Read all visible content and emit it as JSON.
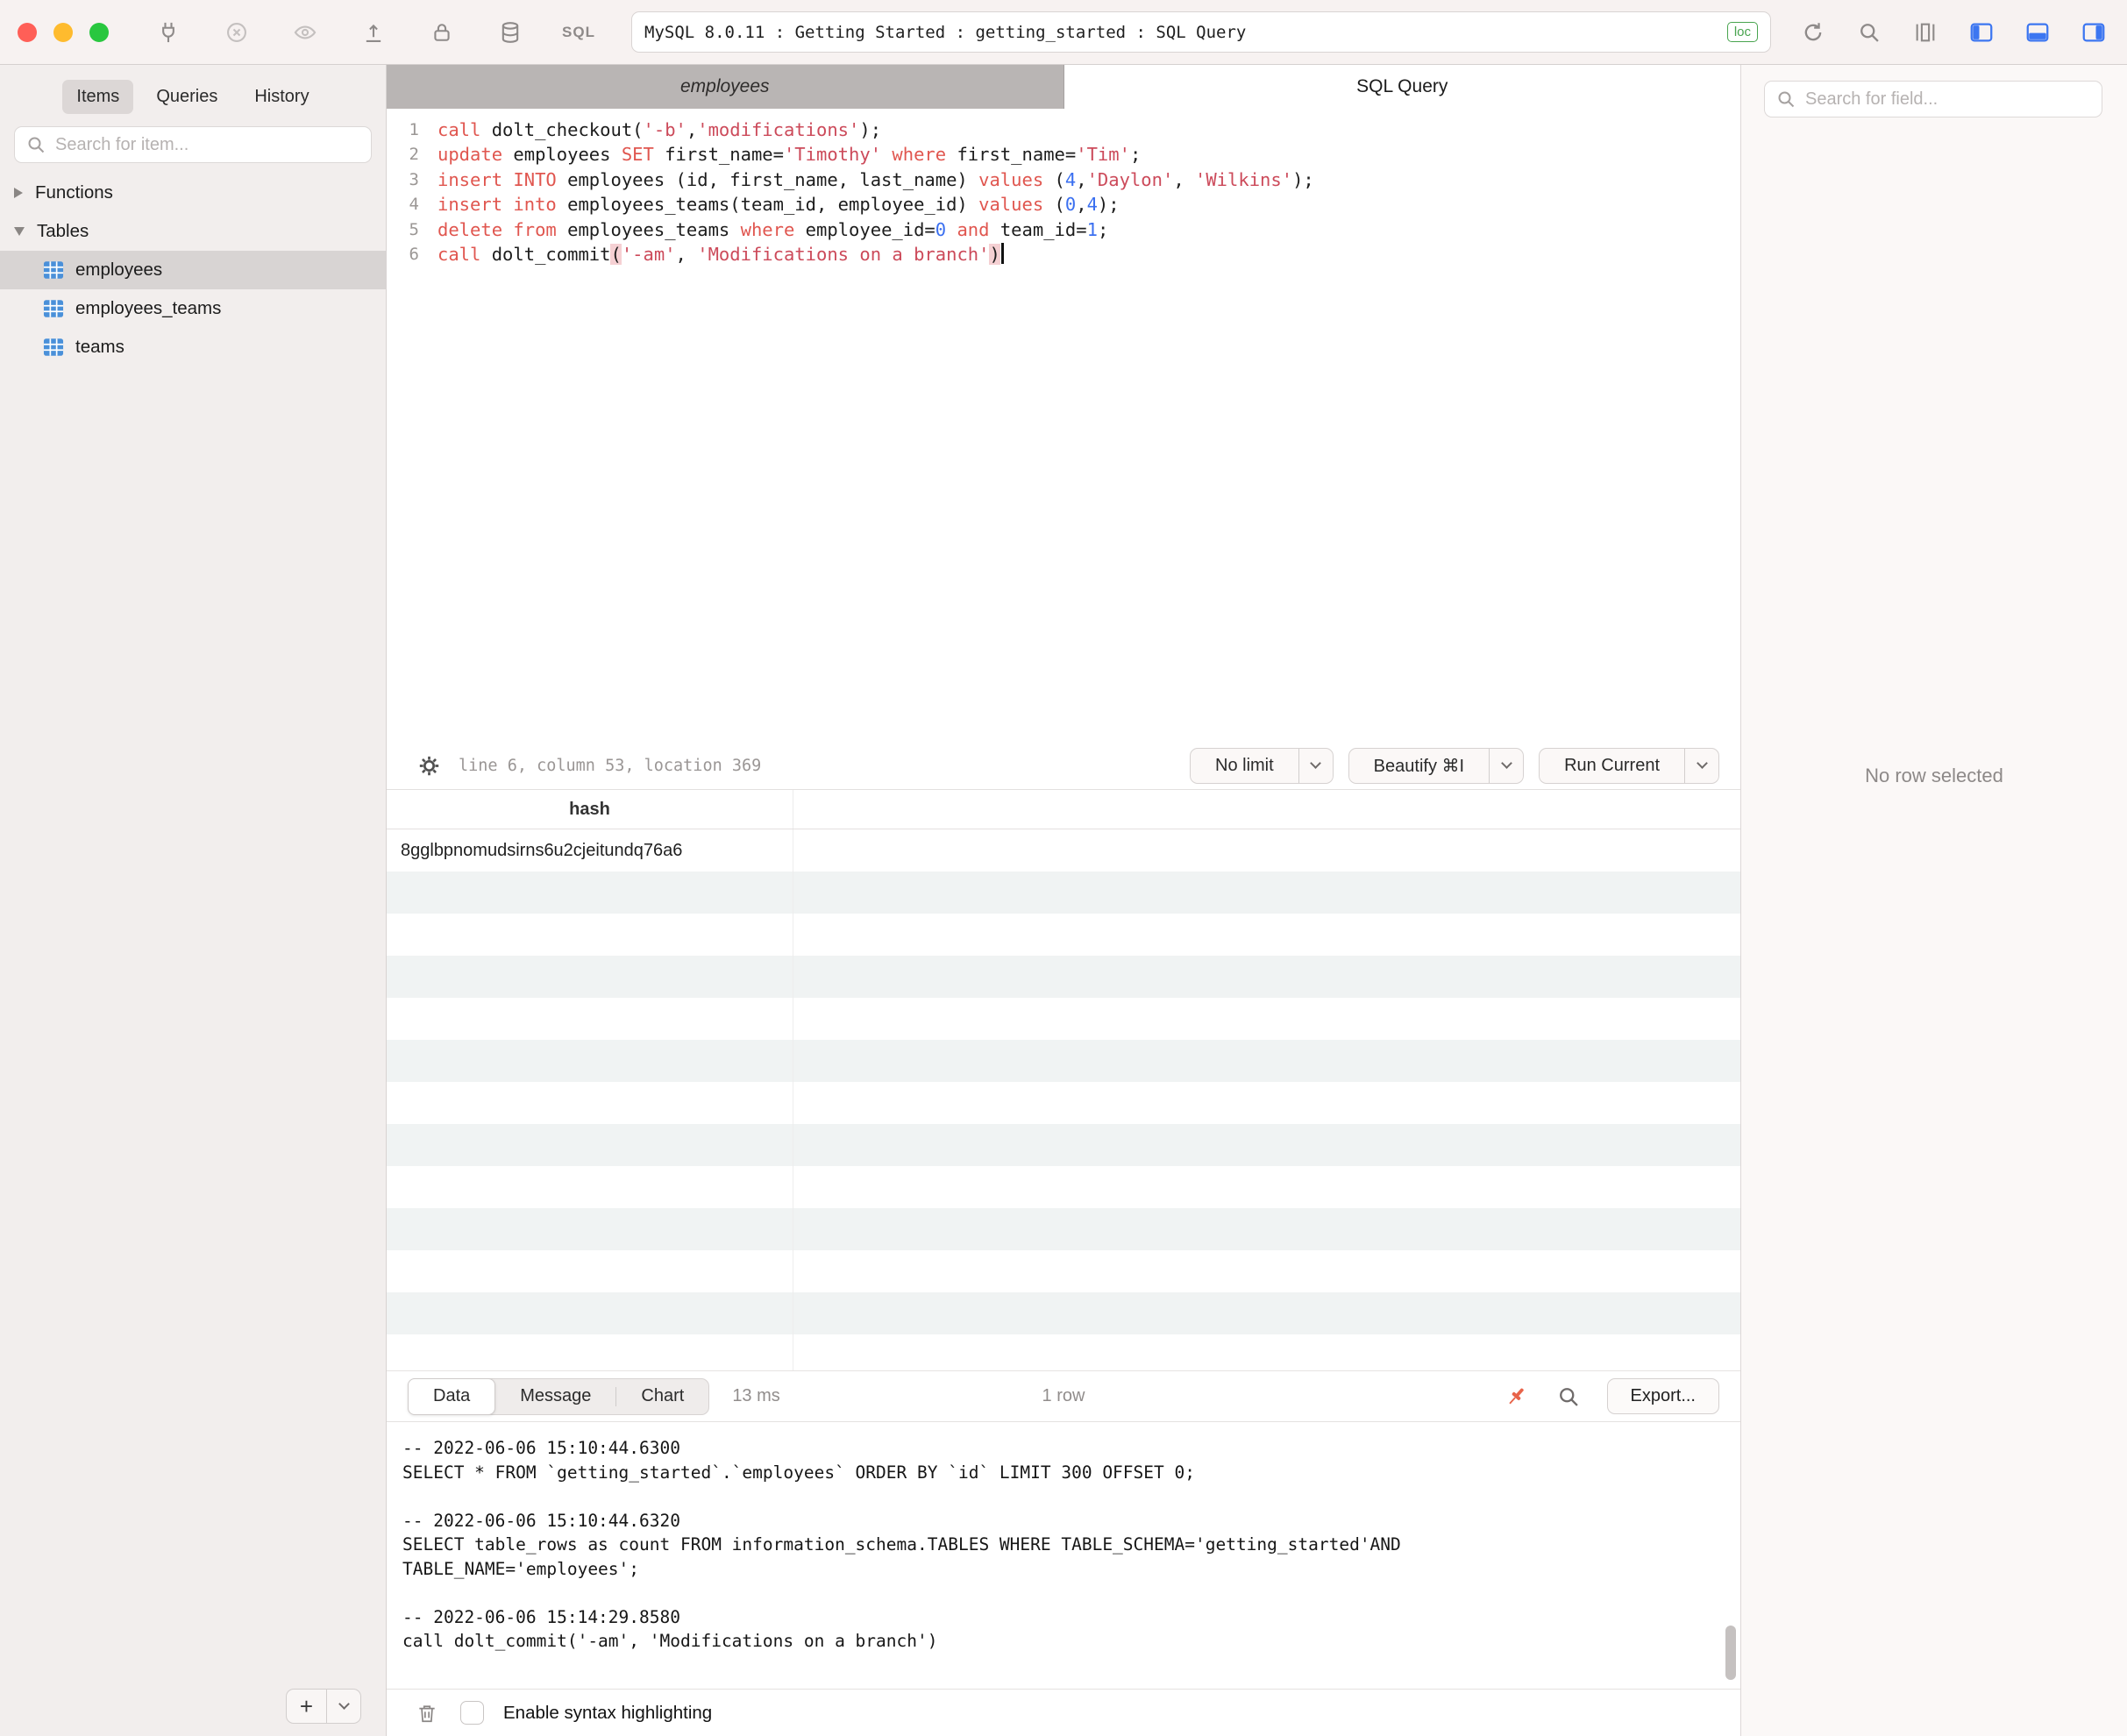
{
  "titlebar": {
    "title": "MySQL 8.0.11 : Getting Started : getting_started : SQL Query",
    "badge": "loc",
    "sql_label": "SQL",
    "icons_left": [
      "connect-icon",
      "disconnect-icon",
      "eye-icon",
      "commit-icon",
      "lock-icon",
      "database-icon",
      "sql-icon"
    ],
    "icons_right": [
      "refresh-icon",
      "search-icon",
      "columns-icon",
      "toggle-left-panel-icon",
      "toggle-bottom-panel-icon",
      "toggle-right-panel-icon"
    ]
  },
  "sidebar": {
    "tabs": [
      {
        "label": "Items",
        "active": true
      },
      {
        "label": "Queries",
        "active": false
      },
      {
        "label": "History",
        "active": false
      }
    ],
    "search_placeholder": "Search for item...",
    "sections": [
      {
        "label": "Functions",
        "expanded": false
      },
      {
        "label": "Tables",
        "expanded": true
      }
    ],
    "tables": [
      {
        "label": "employees",
        "selected": true
      },
      {
        "label": "employees_teams",
        "selected": false
      },
      {
        "label": "teams",
        "selected": false
      }
    ],
    "add_button": "+"
  },
  "editor_tabs": [
    {
      "label": "employees",
      "active": false
    },
    {
      "label": "SQL Query",
      "active": true
    }
  ],
  "editor": {
    "status_text": "line 6, column 53, location 369",
    "buttons": [
      "No limit",
      "Beautify ⌘I",
      "Run Current"
    ],
    "lines": [
      [
        {
          "t": "call",
          "c": "kw"
        },
        {
          "t": " dolt_checkout(",
          "c": "id"
        },
        {
          "t": "'-b'",
          "c": "str"
        },
        {
          "t": ",",
          "c": "id"
        },
        {
          "t": "'modifications'",
          "c": "str"
        },
        {
          "t": ");",
          "c": "id"
        }
      ],
      [
        {
          "t": "update",
          "c": "kw"
        },
        {
          "t": " employees ",
          "c": "id"
        },
        {
          "t": "SET",
          "c": "kw"
        },
        {
          "t": " first_name=",
          "c": "id"
        },
        {
          "t": "'Timothy'",
          "c": "str"
        },
        {
          "t": " ",
          "c": "id"
        },
        {
          "t": "where",
          "c": "kw"
        },
        {
          "t": " first_name=",
          "c": "id"
        },
        {
          "t": "'Tim'",
          "c": "str"
        },
        {
          "t": ";",
          "c": "id"
        }
      ],
      [
        {
          "t": "insert",
          "c": "kw"
        },
        {
          "t": " ",
          "c": "id"
        },
        {
          "t": "INTO",
          "c": "kw"
        },
        {
          "t": " employees (id, first_name, last_name) ",
          "c": "id"
        },
        {
          "t": "values",
          "c": "kw"
        },
        {
          "t": " (",
          "c": "id"
        },
        {
          "t": "4",
          "c": "num"
        },
        {
          "t": ",",
          "c": "id"
        },
        {
          "t": "'Daylon'",
          "c": "str"
        },
        {
          "t": ", ",
          "c": "id"
        },
        {
          "t": "'Wilkins'",
          "c": "str"
        },
        {
          "t": ");",
          "c": "id"
        }
      ],
      [
        {
          "t": "insert",
          "c": "kw"
        },
        {
          "t": " ",
          "c": "id"
        },
        {
          "t": "into",
          "c": "kw"
        },
        {
          "t": " employees_teams(team_id, employee_id) ",
          "c": "id"
        },
        {
          "t": "values",
          "c": "kw"
        },
        {
          "t": " (",
          "c": "id"
        },
        {
          "t": "0",
          "c": "num"
        },
        {
          "t": ",",
          "c": "id"
        },
        {
          "t": "4",
          "c": "num"
        },
        {
          "t": ");",
          "c": "id"
        }
      ],
      [
        {
          "t": "delete",
          "c": "kw"
        },
        {
          "t": " ",
          "c": "id"
        },
        {
          "t": "from",
          "c": "kw"
        },
        {
          "t": " employees_teams ",
          "c": "id"
        },
        {
          "t": "where",
          "c": "kw"
        },
        {
          "t": " employee_id=",
          "c": "id"
        },
        {
          "t": "0",
          "c": "num"
        },
        {
          "t": " ",
          "c": "id"
        },
        {
          "t": "and",
          "c": "kw"
        },
        {
          "t": " team_id=",
          "c": "id"
        },
        {
          "t": "1",
          "c": "num"
        },
        {
          "t": ";",
          "c": "id"
        }
      ],
      [
        {
          "t": "call",
          "c": "kw"
        },
        {
          "t": " dolt_commit",
          "c": "id"
        },
        {
          "t": "(",
          "c": "hl"
        },
        {
          "t": "'-am'",
          "c": "str"
        },
        {
          "t": ", ",
          "c": "id"
        },
        {
          "t": "'Modifications on a branch'",
          "c": "str"
        },
        {
          "t": ")",
          "c": "hl"
        },
        {
          "t": "",
          "c": "cursor"
        }
      ]
    ]
  },
  "results": {
    "columns": [
      "hash"
    ],
    "rows": [
      [
        "8gglbpnomudsirns6u2cjeitundq76a6"
      ]
    ],
    "visible_rows": 13
  },
  "results_toolbar": {
    "segments": [
      {
        "label": "Data",
        "active": true
      },
      {
        "label": "Message",
        "active": false
      },
      {
        "label": "Chart",
        "active": false
      }
    ],
    "elapsed": "13 ms",
    "row_count": "1 row",
    "export_label": "Export..."
  },
  "log": {
    "lines": [
      "-- 2022-06-06 15:10:44.6300",
      "SELECT * FROM `getting_started`.`employees` ORDER BY `id` LIMIT 300 OFFSET 0;",
      "",
      "-- 2022-06-06 15:10:44.6320",
      "SELECT table_rows as count FROM information_schema.TABLES WHERE TABLE_SCHEMA='getting_started'AND",
      "TABLE_NAME='employees';",
      "",
      "-- 2022-06-06 15:14:29.8580",
      "call dolt_commit('-am', 'Modifications on a branch')"
    ]
  },
  "footer": {
    "checkbox_label": "Enable syntax highlighting",
    "checked": false
  },
  "right_panel": {
    "search_placeholder": "Search for field...",
    "empty_text": "No row selected"
  },
  "colors": {
    "keyword": "#e0564f",
    "string": "#cc4a5a",
    "number": "#3a6ff0",
    "accent_blue": "#3c76f1",
    "badge_green": "#49a44f",
    "pin_orange": "#e8644a",
    "selection_gray": "#d8d4d3"
  }
}
